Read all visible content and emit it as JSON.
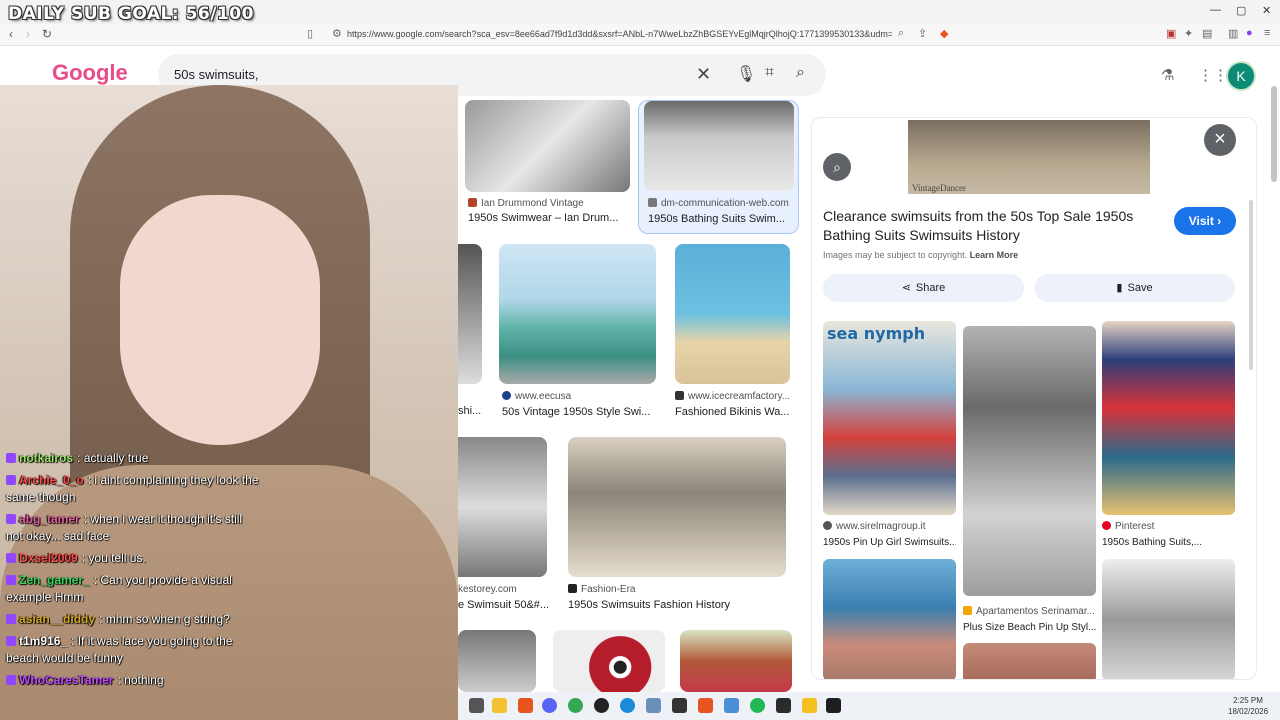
{
  "overlay": {
    "goal_text": "DAILY SUB GOAL: 56/100"
  },
  "browser": {
    "url": "https://www.google.com/search?sca_esv=8ee66ad7f9d1d3dd&sxsrf=ANbL-n7WweLbzZhBGSEYvEglMqjrQlhojQ:1771399530133&udm=2&fbs=ADc_l..."
  },
  "google": {
    "logo": "Google",
    "search_value": "50s swimsuits,",
    "avatar_letter": "K"
  },
  "chat": [
    {
      "user": "notkairos",
      "user_color": "#9be36a",
      "message": "actually true"
    },
    {
      "user": "Archie_0_o",
      "user_color": "#ff4d4d",
      "message": "i aint complaining they look the same though"
    },
    {
      "user": "abg_tamer",
      "user_color": "#e0609e",
      "message": "when i wear it though it's still not okay... sad face"
    },
    {
      "user": "Dxsel2009",
      "user_color": "#ff4d4d",
      "message": "you tell us."
    },
    {
      "user": "Zen_gamer_",
      "user_color": "#3ad15a",
      "message": "Can you provide a visual example Hmm"
    },
    {
      "user": "asian__diddy",
      "user_color": "#d4a62a",
      "message": "mhm so when g string?"
    },
    {
      "user": "t1m916_",
      "user_color": "#ffffff",
      "message": "If it was lace you going to the beach would be funny"
    },
    {
      "user": "WhoCaresTamer",
      "user_color": "#c04bff",
      "message": "nothing"
    }
  ],
  "results": [
    {
      "source": "Ian Drummond Vintage",
      "title": "1950s Swimwear – Ian Drum..."
    },
    {
      "source": "dm-communication-web.com",
      "title": "1950s Bathing Suits Swim..."
    },
    {
      "source": "",
      "title": "shi..."
    },
    {
      "source": "www.eecusa",
      "title": "50s Vintage 1950s Style Swi..."
    },
    {
      "source": "www.icecreamfactory...",
      "title": "Fashioned Bikinis Wa..."
    },
    {
      "source": "kestorey.com",
      "title": "e Swimsuit 50&#..."
    },
    {
      "source": "Fashion-Era",
      "title": "1950s Swimsuits Fashion History"
    }
  ],
  "preview": {
    "watermark": "VintageDancer",
    "title": "Clearance swimsuits from the 50s Top Sale 1950s Bathing Suits Swimsuits History",
    "visit_label": "Visit",
    "subject_note": "Images may be subject to copyright.",
    "learn_more": "Learn More",
    "share_label": "Share",
    "save_label": "Save",
    "related": [
      {
        "image_text": "sea nymph",
        "source": "www.sirelmagroup.it",
        "title": "1950s Pin Up Girl Swimsuits..."
      },
      {
        "source": "Pinterest",
        "title": "1950s Bathing Suits,..."
      },
      {
        "source": "Apartamentos Serinamar...",
        "title": "Plus Size Beach Pin Up Styl..."
      }
    ]
  },
  "taskbar": {
    "time": "2:25 PM",
    "date": "18/02/2026"
  }
}
